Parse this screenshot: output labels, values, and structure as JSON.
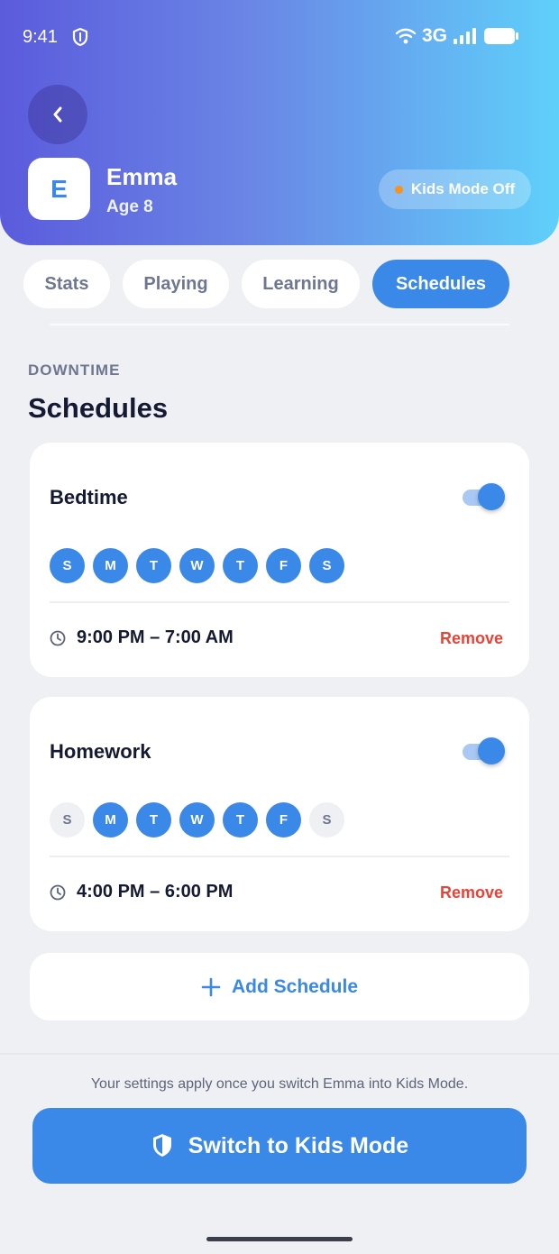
{
  "status_bar": {
    "time": "9:41",
    "network": "3G"
  },
  "profile": {
    "initial": "E",
    "name": "Emma",
    "age": "Age 8"
  },
  "kids_mode_badge": {
    "label": "Kids Mode Off",
    "dot_color": "#f6921e"
  },
  "tabs": [
    {
      "label": "Stats",
      "active": false
    },
    {
      "label": "Playing",
      "active": false
    },
    {
      "label": "Learning",
      "active": false
    },
    {
      "label": "Schedules",
      "active": true
    }
  ],
  "section": {
    "label": "DOWNTIME",
    "title": "Schedules"
  },
  "schedules": [
    {
      "name": "Bedtime",
      "enabled": true,
      "days": [
        {
          "letter": "S",
          "on": true
        },
        {
          "letter": "M",
          "on": true
        },
        {
          "letter": "T",
          "on": true
        },
        {
          "letter": "W",
          "on": true
        },
        {
          "letter": "T",
          "on": true
        },
        {
          "letter": "F",
          "on": true
        },
        {
          "letter": "S",
          "on": true
        }
      ],
      "time_range": "9:00 PM – 7:00 AM",
      "remove_label": "Remove"
    },
    {
      "name": "Homework",
      "enabled": true,
      "days": [
        {
          "letter": "S",
          "on": false
        },
        {
          "letter": "M",
          "on": true
        },
        {
          "letter": "T",
          "on": true
        },
        {
          "letter": "W",
          "on": true
        },
        {
          "letter": "T",
          "on": true
        },
        {
          "letter": "F",
          "on": true
        },
        {
          "letter": "S",
          "on": false
        }
      ],
      "time_range": "4:00 PM – 6:00 PM",
      "remove_label": "Remove"
    }
  ],
  "add_schedule_label": "Add Schedule",
  "footer": {
    "note": "Your settings apply once you switch Emma into Kids Mode.",
    "cta_label": "Switch to Kids Mode"
  },
  "colors": {
    "accent": "#3a88e8",
    "danger": "#ea4236",
    "header_gradient_start": "#5b5bdc",
    "header_gradient_end": "#5fd0fa"
  },
  "icons": [
    "shield-icon",
    "wifi-icon",
    "signal-icon",
    "battery-icon",
    "back-arrow-icon",
    "clock-icon",
    "plus-icon",
    "shield-icon"
  ]
}
